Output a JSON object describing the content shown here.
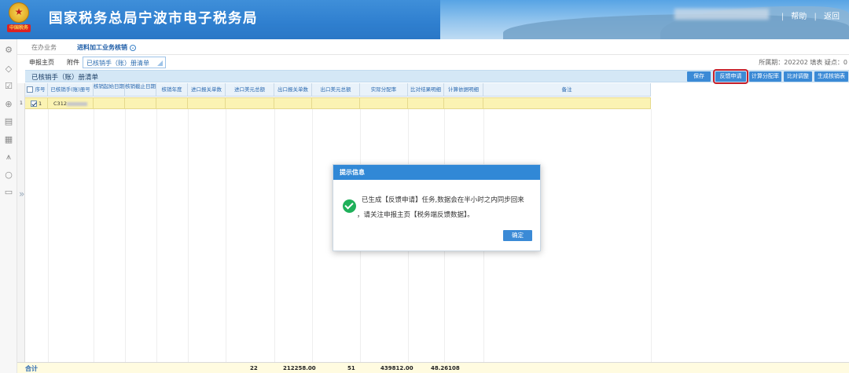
{
  "header": {
    "emblem_text": "中国税务",
    "title": "国家税务总局宁波市电子税务局",
    "links": [
      "帮助",
      "返回"
    ]
  },
  "tabs1": {
    "items": [
      "在办业务",
      "进料加工业务核销"
    ]
  },
  "tabs2": {
    "items": [
      "申报主页",
      "附件"
    ],
    "active_pill": "已核销手（账）册清单",
    "right_info": "所属期：202202  填表  疑点：0"
  },
  "toolbar": {
    "title": "已核销手（账）册清单",
    "buttons": [
      "保存",
      "反馈申请",
      "计算分配率",
      "比对调整",
      "生成核销表"
    ]
  },
  "table": {
    "columns": [
      "序号",
      "已核销手(账)册号",
      "核销起始日期",
      "核销截止日期",
      "核销年度",
      "进口报关单数",
      "进口美元总额",
      "出口报关单数",
      "出口美元总额",
      "实际分配率",
      "比对结果明细",
      "计算依据明细",
      "备注"
    ],
    "rows": [
      {
        "row_no": "1",
        "seq": "1",
        "book_no": "C312"
      }
    ]
  },
  "footer": {
    "label": "合计",
    "values": [
      "22",
      "212258.00",
      "51",
      "439812.00",
      "48.26108"
    ]
  },
  "dialog": {
    "title": "提示信息",
    "line1": "已生成【反馈申请】任务,数据会在半小时之内同步回来",
    "line2": "，请关注申报主页【税务端反馈数据】。",
    "ok": "确定"
  },
  "colors": {
    "header_blue": "#2f7fcf",
    "button_blue": "#3b8ad6",
    "selected_row": "#fbf3b3",
    "highlight_border": "#c8202a",
    "success_green": "#1fb05a"
  }
}
